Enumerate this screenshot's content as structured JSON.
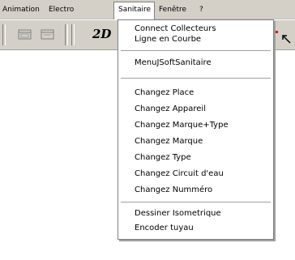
{
  "menubar": {
    "items": [
      {
        "label": "Animation"
      },
      {
        "label": "Electro"
      },
      {
        "label": "Sanitaire"
      },
      {
        "label": "Fenêtre"
      },
      {
        "label": "?"
      }
    ]
  },
  "toolbar": {
    "view_mode_label": "2D",
    "buttons": [
      {
        "icon": "toolbar-button-icon"
      },
      {
        "icon": "toolbar-button-icon"
      }
    ],
    "accent_color": "#e00000"
  },
  "dropdown": {
    "groups": [
      [
        "Connect Collecteurs",
        "Ligne en Courbe"
      ],
      [
        "MenuJSoftSanitaire"
      ],
      [
        "Changez Place",
        "Changez Appareil",
        "Changez Marque+Type",
        "Changez Marque",
        "Changez Type",
        "Changez Circuit d'eau",
        "Changez Numméro"
      ],
      [
        "Dessiner Isometrique",
        "Encoder tuyau"
      ]
    ]
  }
}
